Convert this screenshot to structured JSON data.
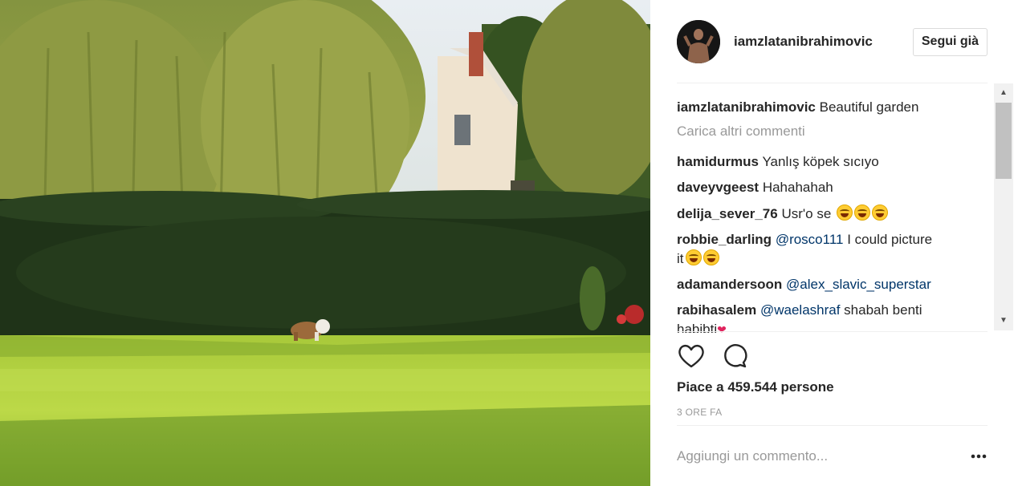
{
  "post": {
    "photo_alt": "Bulldog in garden",
    "username": "iamzlatanibrahimovic",
    "follow_label": "Segui già",
    "caption_user": "iamzlatanibrahimovic",
    "caption_text": "Beautiful garden",
    "load_more": "Carica altri commenti",
    "likes": "Piace a 459.544 persone",
    "time": "3 ORE FA",
    "comment_placeholder": "Aggiungi un commento..."
  },
  "comments": [
    {
      "user": "hamidurmus",
      "text": "Yanlış köpek sıcıyo"
    },
    {
      "user": "daveyvgeest",
      "text": "Hahahahah"
    },
    {
      "user": "delija_sever_76",
      "text": "Usr'o se",
      "emoji_count": 3
    },
    {
      "user": "robbie_darling",
      "mention": "@rosco111",
      "text": "I could picture",
      "text2": "it",
      "emoji_count": 2
    },
    {
      "user": "adamandersoon",
      "mention": "@alex_slavic_superstar"
    },
    {
      "user": "rabihasalem",
      "mention": "@waelashraf",
      "text": "shabah benti",
      "text2": "habibti"
    }
  ],
  "icons": {
    "like": "heart-icon",
    "comment": "comment-bubble-icon",
    "more": "more-options-icon"
  },
  "colors": {
    "text": "#262626",
    "muted": "#999999",
    "link": "#003569",
    "divider": "#efefef"
  }
}
